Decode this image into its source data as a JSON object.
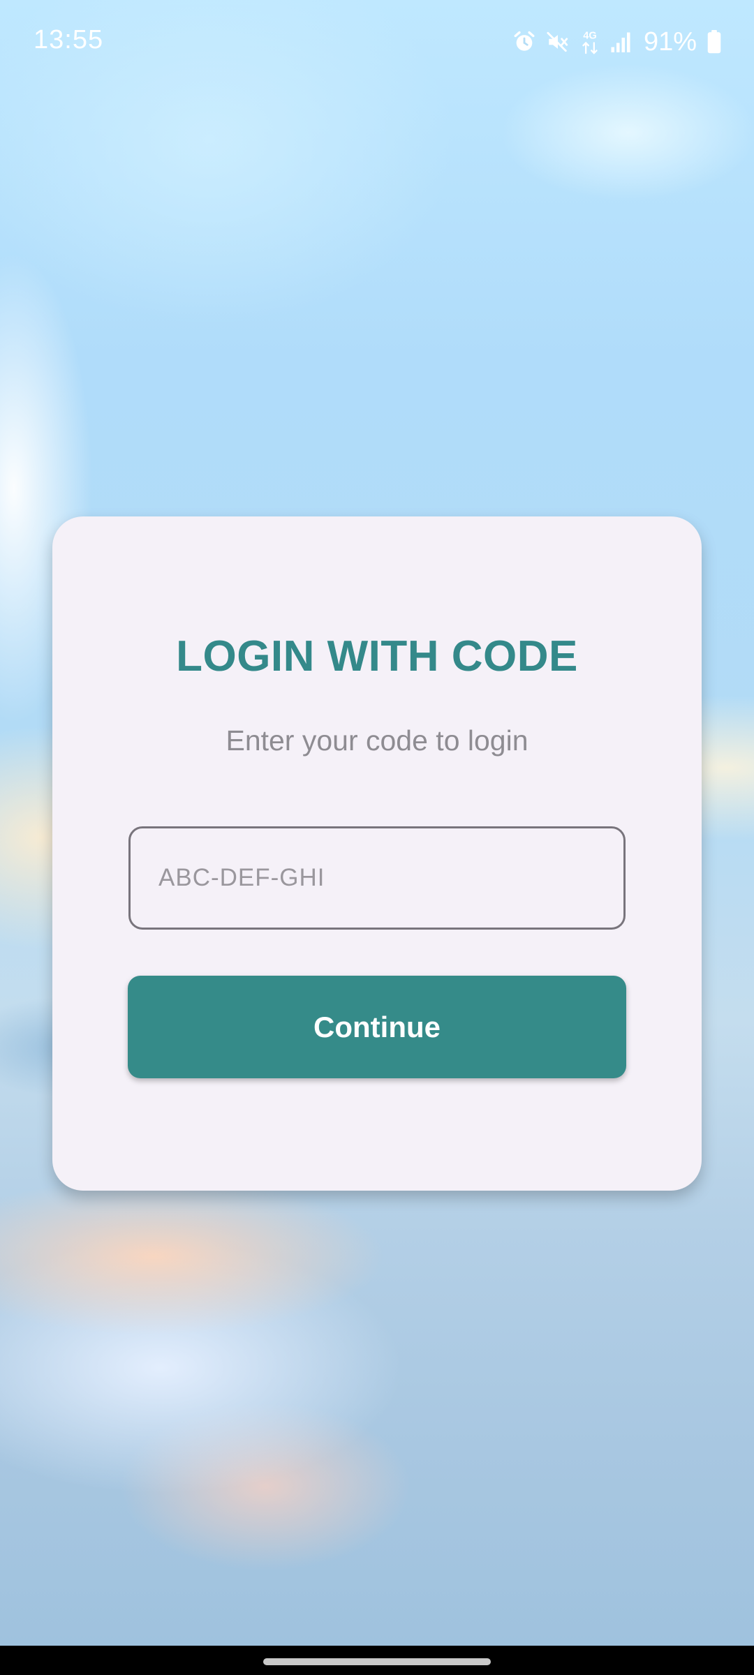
{
  "status_bar": {
    "time": "13:55",
    "battery_percent": "91%",
    "network_label": "4G",
    "icons": [
      "alarm-icon",
      "mute-icon",
      "network-4g-icon",
      "signal-icon",
      "battery-icon"
    ]
  },
  "login": {
    "title": "LOGIN WITH CODE",
    "subtitle": "Enter your code to login",
    "code_placeholder": "ABC-DEF-GHI",
    "code_value": "",
    "continue_label": "Continue"
  },
  "colors": {
    "accent": "#358b89",
    "title": "#34898a",
    "card_background": "#f5f1f8",
    "subtitle": "#8e8c92"
  }
}
